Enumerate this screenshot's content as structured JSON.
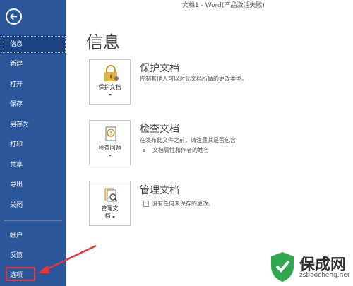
{
  "window": {
    "title": "文档1 - Word(产品激活失败)"
  },
  "sidebar": {
    "items": [
      {
        "label": "信息"
      },
      {
        "label": "新建"
      },
      {
        "label": "打开"
      },
      {
        "label": "保存"
      },
      {
        "label": "另存为"
      },
      {
        "label": "打印"
      },
      {
        "label": "共享"
      },
      {
        "label": "导出"
      },
      {
        "label": "关闭"
      },
      {
        "label": "帐户"
      },
      {
        "label": "反馈"
      },
      {
        "label": "选项"
      }
    ]
  },
  "main": {
    "title": "信息",
    "sections": [
      {
        "button_label": "保护文档",
        "title": "保护文档",
        "description": "控制其他人可以对此文档所做的更改类型。"
      },
      {
        "button_label": "检查问题",
        "title": "检查文档",
        "description": "在发布此文件之前，请注意其是否包含:",
        "bullets": [
          "文档属性和作者的姓名"
        ]
      },
      {
        "button_label_line1": "管理文",
        "button_label_line2": "档",
        "title": "管理文档",
        "description": "没有任何未保存的更改。"
      }
    ]
  },
  "watermark": {
    "text": "保成网",
    "url": "zsbaocheng.net"
  },
  "colors": {
    "sidebar": "#2b579a",
    "active": "#1e4480",
    "highlight": "#e8353a",
    "watermark_green": "#2fa84f"
  }
}
